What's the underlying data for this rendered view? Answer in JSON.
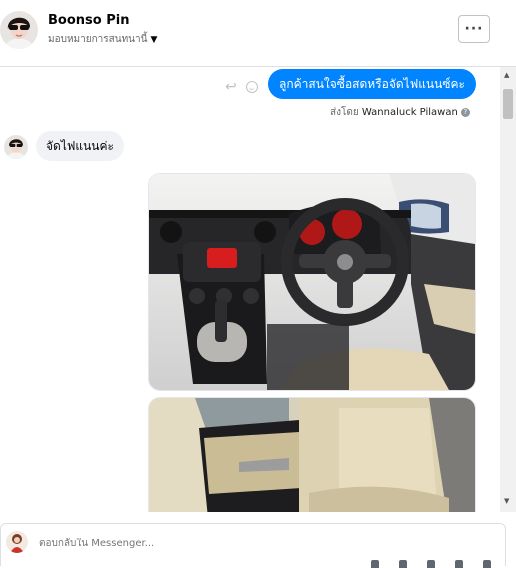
{
  "header": {
    "name": "Boonso Pin",
    "assign_label": "มอบหมายการสนทนานี้",
    "more_label": "···"
  },
  "thread": {
    "outgoing_message": "ลูกค้าสนใจซื้อสดหรือจัดไฟแนนซ์คะ",
    "sent_by_prefix": "ส่งโดย",
    "sent_by_name": "Wannaluck Pilawan",
    "incoming_message": "จัดไฟแนนค่ะ"
  },
  "composer": {
    "placeholder": "ตอบกลับใน Messenger..."
  },
  "colors": {
    "accent": "#0084ff",
    "incoming_bubble": "#f0f2f5"
  }
}
